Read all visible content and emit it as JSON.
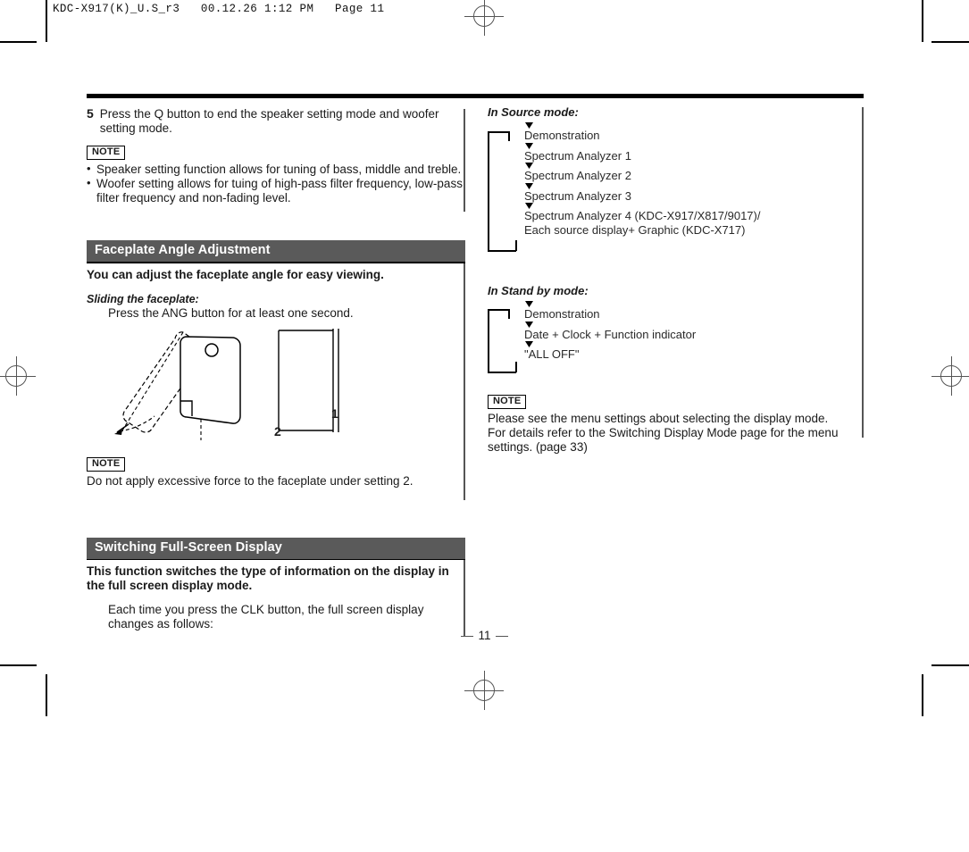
{
  "print_header": "KDC-X917(K)_U.S_r3   00.12.26 1:12 PM   Page 11",
  "page_number": "11",
  "left_column": {
    "step": {
      "number": "5",
      "text": "Press the Q button to end the speaker setting mode and woofer setting mode."
    },
    "note_1": {
      "tag": "NOTE",
      "bullets": [
        "Speaker setting function allows for tuning of bass, middle and treble.",
        "Woofer setting allows for tuing of high-pass filter frequency, low-pass filter frequency and non-fading level."
      ]
    },
    "section_1": {
      "heading": "Faceplate Angle Adjustment",
      "lead": "You can adjust the faceplate angle for easy viewing.",
      "subhead": "Sliding the faceplate:",
      "instruction": "Press the ANG button for at least one second.",
      "figure": {
        "label_1": "1",
        "label_2": "2"
      },
      "note": {
        "tag": "NOTE",
        "text": "Do not apply excessive force to the faceplate under setting 2."
      }
    },
    "section_2": {
      "heading": "Switching Full-Screen Display",
      "lead": "This function switches the type of information on the display in the full screen display mode.",
      "instruction": "Each time you press the CLK button, the full screen display changes as follows:"
    }
  },
  "right_column": {
    "source_mode": {
      "title": "In Source mode:",
      "items": [
        "Demonstration",
        "Spectrum Analyzer 1",
        "Spectrum Analyzer 2",
        "Spectrum Analyzer 3",
        "Spectrum Analyzer 4 (KDC-X917/X817/9017)/",
        "Each source display+ Graphic (KDC-X717)"
      ]
    },
    "standby_mode": {
      "title": "In Stand by mode:",
      "items": [
        "Demonstration",
        "Date + Clock + Function indicator",
        "\"ALL OFF\""
      ]
    },
    "note": {
      "tag": "NOTE",
      "text": "Please see the menu settings about selecting the display mode. For details refer to the Switching Display Mode page for the menu settings. (page 33)"
    }
  },
  "colors": {
    "section_heading_bg": "#5a5a5a",
    "rule": "#000000",
    "divider": "#555555"
  }
}
